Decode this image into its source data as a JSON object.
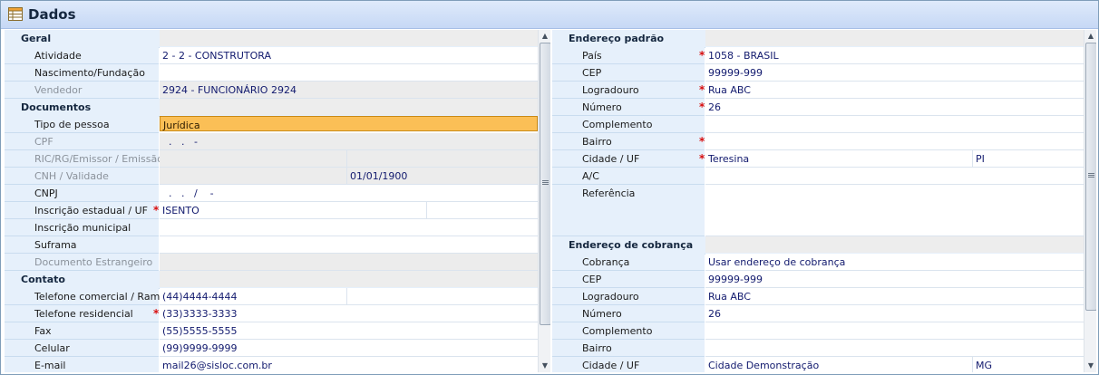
{
  "window": {
    "title": "Dados",
    "title_icon": "table-form-icon"
  },
  "left": {
    "sections": {
      "geral": "Geral",
      "documentos": "Documentos",
      "contato": "Contato"
    },
    "rows": {
      "atividade": {
        "label": "Atividade",
        "value": "2 - 2 - CONSTRUTORA"
      },
      "nascimento": {
        "label": "Nascimento/Fundação",
        "value": ""
      },
      "vendedor": {
        "label": "Vendedor",
        "value": "2924 - FUNCIONÁRIO  2924"
      },
      "tipo_pessoa": {
        "label": "Tipo de pessoa",
        "value": "Jurídica"
      },
      "cpf": {
        "label": "CPF",
        "value": "  .   .   -"
      },
      "ric": {
        "label": "RIC/RG/Emissor / Emissão",
        "value": "",
        "value2": ""
      },
      "cnh": {
        "label": "CNH / Validade",
        "value": "",
        "value2": "01/01/1900"
      },
      "cnpj": {
        "label": "CNPJ",
        "value": "  .   .   /    -"
      },
      "ie": {
        "label": "Inscrição estadual / UF",
        "value": "ISENTO",
        "value2": ""
      },
      "im": {
        "label": "Inscrição municipal",
        "value": ""
      },
      "suframa": {
        "label": "Suframa",
        "value": ""
      },
      "doc_estrangeiro": {
        "label": "Documento Estrangeiro",
        "value": ""
      },
      "tel_comercial": {
        "label": "Telefone comercial / Ramal",
        "value": "(44)4444-4444",
        "value2": ""
      },
      "tel_residencial": {
        "label": "Telefone residencial",
        "value": "(33)3333-3333"
      },
      "fax": {
        "label": "Fax",
        "value": "(55)5555-5555"
      },
      "celular": {
        "label": "Celular",
        "value": "(99)9999-9999"
      },
      "email": {
        "label": "E-mail",
        "value": "mail26@sisloc.com.br"
      }
    }
  },
  "right": {
    "sections": {
      "endereco_padrao": "Endereço padrão",
      "endereco_cobranca": "Endereço de cobrança"
    },
    "rows": {
      "pais": {
        "label": "País",
        "value": "1058 - BRASIL"
      },
      "cep": {
        "label": "CEP",
        "value": "99999-999"
      },
      "logradouro": {
        "label": "Logradouro",
        "value": "Rua ABC"
      },
      "numero": {
        "label": "Número",
        "value": "26"
      },
      "complemento": {
        "label": "Complemento",
        "value": ""
      },
      "bairro": {
        "label": "Bairro",
        "value": ""
      },
      "cidade_uf": {
        "label": "Cidade / UF",
        "value": "Teresina",
        "value2": "PI"
      },
      "ac": {
        "label": "A/C",
        "value": ""
      },
      "referencia": {
        "label": "Referência",
        "value": ""
      },
      "cob_cobranca": {
        "label": "Cobrança",
        "value": "Usar endereço de cobrança"
      },
      "cob_cep": {
        "label": "CEP",
        "value": "99999-999"
      },
      "cob_logradouro": {
        "label": "Logradouro",
        "value": "Rua ABC"
      },
      "cob_numero": {
        "label": "Número",
        "value": "26"
      },
      "cob_complemento": {
        "label": "Complemento",
        "value": ""
      },
      "cob_bairro": {
        "label": "Bairro",
        "value": ""
      },
      "cob_cidade_uf": {
        "label": "Cidade / UF",
        "value": "Cidade Demonstração",
        "value2": "MG"
      }
    }
  },
  "required_marker": "*",
  "colors": {
    "selected_row": "#fbbf56",
    "required": "#d90e0e",
    "label_bg": "#e6f0fb"
  }
}
